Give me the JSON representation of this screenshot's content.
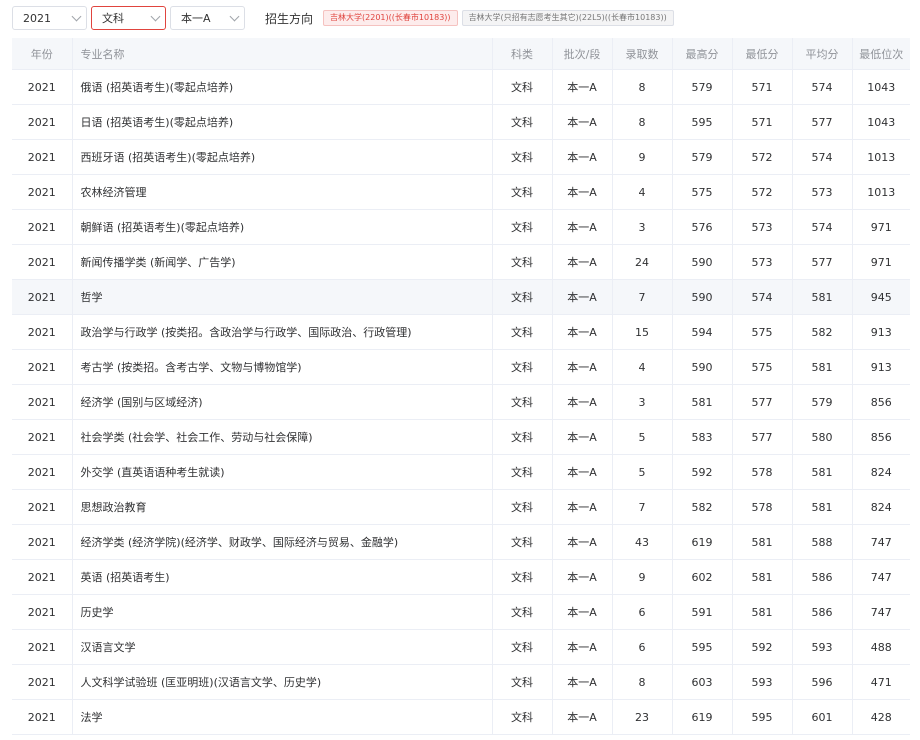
{
  "filters": {
    "year": "2021",
    "subject": "文科",
    "batch": "本一A",
    "direction_label": "招生方向",
    "directions": [
      "吉林大学(2201)((长春市10183))",
      "吉林大学(只招有志愿考生其它)(22L5)((长春市10183))"
    ]
  },
  "table": {
    "headers": [
      "年份",
      "专业名称",
      "科类",
      "批次/段",
      "录取数",
      "最高分",
      "最低分",
      "平均分",
      "最低位次"
    ],
    "rows": [
      [
        "2021",
        "俄语 (招英语考生)(零起点培养)",
        "文科",
        "本一A",
        "8",
        "579",
        "571",
        "574",
        "1043"
      ],
      [
        "2021",
        "日语 (招英语考生)(零起点培养)",
        "文科",
        "本一A",
        "8",
        "595",
        "571",
        "577",
        "1043"
      ],
      [
        "2021",
        "西班牙语 (招英语考生)(零起点培养)",
        "文科",
        "本一A",
        "9",
        "579",
        "572",
        "574",
        "1013"
      ],
      [
        "2021",
        "农林经济管理",
        "文科",
        "本一A",
        "4",
        "575",
        "572",
        "573",
        "1013"
      ],
      [
        "2021",
        "朝鲜语 (招英语考生)(零起点培养)",
        "文科",
        "本一A",
        "3",
        "576",
        "573",
        "574",
        "971"
      ],
      [
        "2021",
        "新闻传播学类 (新闻学、广告学)",
        "文科",
        "本一A",
        "24",
        "590",
        "573",
        "577",
        "971"
      ],
      [
        "2021",
        "哲学",
        "文科",
        "本一A",
        "7",
        "590",
        "574",
        "581",
        "945"
      ],
      [
        "2021",
        "政治学与行政学 (按类招。含政治学与行政学、国际政治、行政管理)",
        "文科",
        "本一A",
        "15",
        "594",
        "575",
        "582",
        "913"
      ],
      [
        "2021",
        "考古学 (按类招。含考古学、文物与博物馆学)",
        "文科",
        "本一A",
        "4",
        "590",
        "575",
        "581",
        "913"
      ],
      [
        "2021",
        "经济学 (国别与区域经济)",
        "文科",
        "本一A",
        "3",
        "581",
        "577",
        "579",
        "856"
      ],
      [
        "2021",
        "社会学类 (社会学、社会工作、劳动与社会保障)",
        "文科",
        "本一A",
        "5",
        "583",
        "577",
        "580",
        "856"
      ],
      [
        "2021",
        "外交学 (直英语语种考生就读)",
        "文科",
        "本一A",
        "5",
        "592",
        "578",
        "581",
        "824"
      ],
      [
        "2021",
        "思想政治教育",
        "文科",
        "本一A",
        "7",
        "582",
        "578",
        "581",
        "824"
      ],
      [
        "2021",
        "经济学类 (经济学院)(经济学、财政学、国际经济与贸易、金融学)",
        "文科",
        "本一A",
        "43",
        "619",
        "581",
        "588",
        "747"
      ],
      [
        "2021",
        "英语 (招英语考生)",
        "文科",
        "本一A",
        "9",
        "602",
        "581",
        "586",
        "747"
      ],
      [
        "2021",
        "历史学",
        "文科",
        "本一A",
        "6",
        "591",
        "581",
        "586",
        "747"
      ],
      [
        "2021",
        "汉语言文学",
        "文科",
        "本一A",
        "6",
        "595",
        "592",
        "593",
        "488"
      ],
      [
        "2021",
        "人文科学试验班 (匡亚明班)(汉语言文学、历史学)",
        "文科",
        "本一A",
        "8",
        "603",
        "593",
        "596",
        "471"
      ],
      [
        "2021",
        "法学",
        "文科",
        "本一A",
        "23",
        "619",
        "595",
        "601",
        "428"
      ]
    ]
  }
}
